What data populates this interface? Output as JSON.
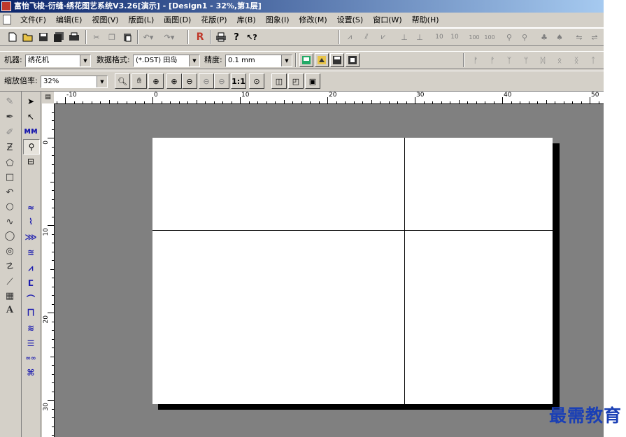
{
  "titlebar": {
    "title": "富怡飞梭-衍缝-绣花图艺系统V3.26[演示] - [Design1 - 32%,第1层]"
  },
  "menu": [
    "文件(F)",
    "编辑(E)",
    "视图(V)",
    "版面(L)",
    "画图(D)",
    "花版(P)",
    "库(B)",
    "图象(I)",
    "修改(M)",
    "设置(S)",
    "窗口(W)",
    "帮助(H)"
  ],
  "toolbar1": {
    "icons": [
      "new-icon",
      "open-icon",
      "save-icon",
      "save-all-icon",
      "print-setup-icon",
      "cut-icon",
      "copy-icon",
      "paste-icon",
      "undo-icon",
      "redo-icon",
      "run-icon",
      "print-icon",
      "help-icon",
      "context-help-icon"
    ]
  },
  "toolbar2": {
    "machine_label": "机器:",
    "machine_value": "绣花机",
    "format_label": "数据格式:",
    "format_value": "(*.DST) 田岛",
    "precision_label": "精度:",
    "precision_value": "0.1 mm"
  },
  "toolbar3": {
    "zoom_label": "缩放倍率:",
    "zoom_value": "32%",
    "one_to_one": "1:1"
  },
  "ruler": {
    "h_labels": [
      "-10",
      "0",
      "10",
      "20",
      "30",
      "40",
      "50"
    ],
    "v_labels": [
      "0",
      "10",
      "20",
      "30"
    ]
  },
  "watermark": "最需教育"
}
